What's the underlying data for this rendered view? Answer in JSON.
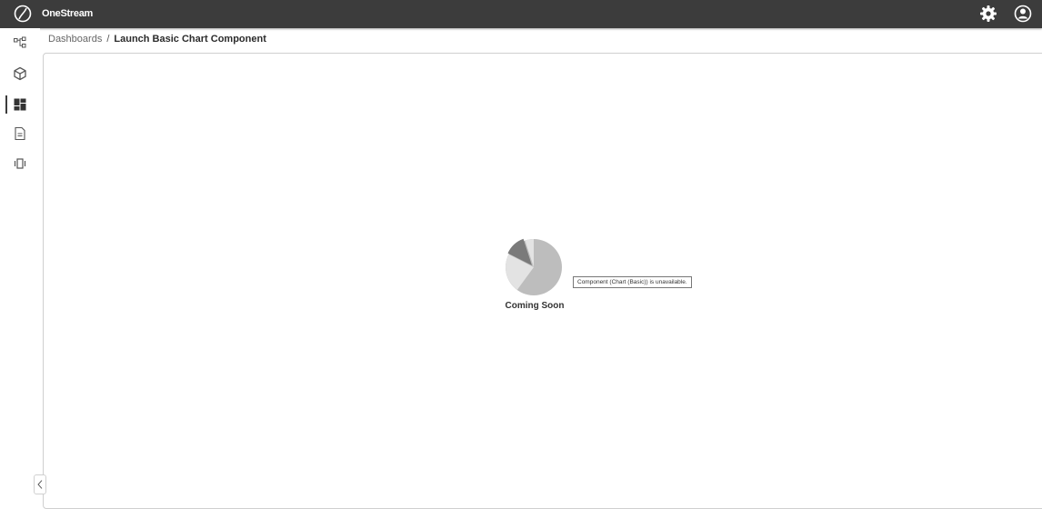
{
  "app": {
    "title": "OneStream"
  },
  "topbar": {
    "logo_icon": "onestream-logo-icon",
    "settings_icon": "gear-icon",
    "user_icon": "user-avatar-icon"
  },
  "rail": {
    "items": [
      {
        "icon": "hierarchy-icon",
        "active": false
      },
      {
        "icon": "cube-icon",
        "active": false
      },
      {
        "icon": "dashboard-icon",
        "active": true
      },
      {
        "icon": "document-icon",
        "active": false
      },
      {
        "icon": "carousel-icon",
        "active": false
      }
    ],
    "collapse_icon": "chevron-left-icon"
  },
  "breadcrumb": {
    "parent": "Dashboards",
    "separator": "/",
    "current": "Launch Basic Chart Component"
  },
  "placeholder": {
    "icon": "pie-chart-icon",
    "label": "Coming Soon",
    "message": "Component (Chart (Basic)) is unavailable."
  },
  "colors": {
    "topbar": "#3c3c3c",
    "pie_dark": "#7a7a7a",
    "pie_mid": "#bdbdbd",
    "pie_light": "#e3e3e3"
  }
}
